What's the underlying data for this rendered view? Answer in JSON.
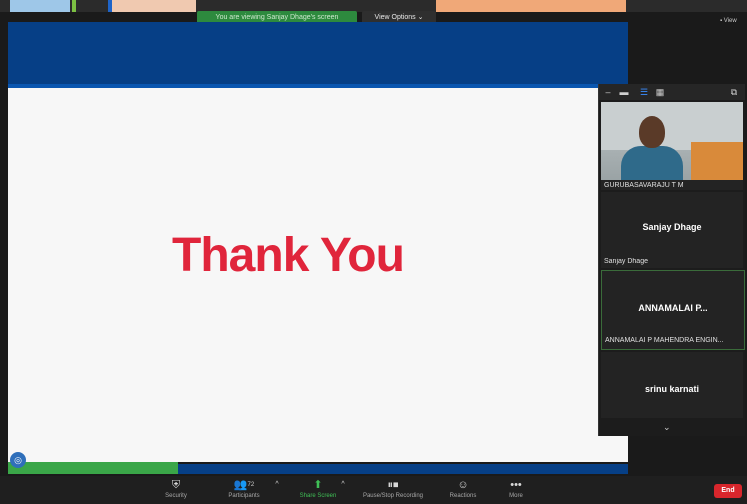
{
  "banner": {
    "share_text": "You are viewing Sanjay Dhage's screen",
    "view_options": "View Options ⌄",
    "view_corner": "View"
  },
  "slide": {
    "text": "Thank You"
  },
  "gallery": {
    "tiles": [
      {
        "name": "GURUBASAVARAJU T M",
        "has_video": true
      },
      {
        "display_name": "Sanjay Dhage",
        "name": "Sanjay Dhage"
      },
      {
        "display_name": "ANNAMALAI P...",
        "name": "ANNAMALAI P MAHENDRA ENGIN..."
      },
      {
        "display_name": "srinu karnati"
      }
    ]
  },
  "toolbar": {
    "security": "Security",
    "participants": "Participants",
    "participants_count": "72",
    "share_screen": "Share Screen",
    "recording": "Pause/Stop Recording",
    "reactions": "Reactions",
    "more": "More",
    "end": "End"
  },
  "colors": {
    "slide_blue": "#063f86",
    "accent_green": "#3aa648",
    "thank_you_red": "#e0253b",
    "end_red": "#d8262c"
  }
}
